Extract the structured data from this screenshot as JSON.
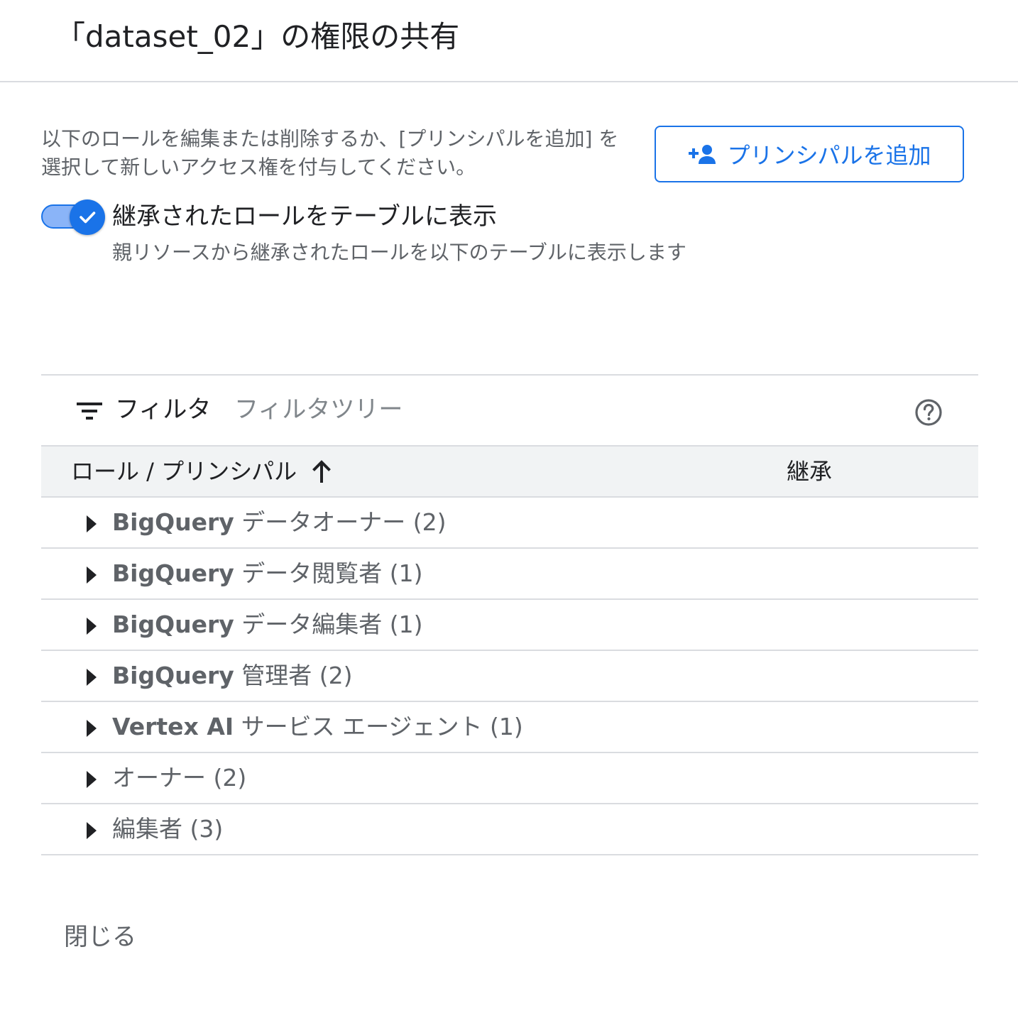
{
  "dialog": {
    "title": "「dataset_02」の権限の共有",
    "description": "以下のロールを編集または削除するか、[プリンシパルを追加] を選択して新しいアクセス権を付与してください。",
    "add_principal_label": "プリンシパルを追加",
    "close_label": "閉じる"
  },
  "toggle": {
    "checked": true,
    "label": "継承されたロールをテーブルに表示",
    "help": "親リソースから継承されたロールを以下のテーブルに表示します"
  },
  "filter": {
    "label": "フィルタ",
    "placeholder": "フィルタツリー"
  },
  "table": {
    "headers": {
      "role": "ロール / プリンシパル",
      "inherited": "継承"
    },
    "sort": "ascending",
    "rows": [
      {
        "prefix": "BigQuery",
        "label": " データオーナー (2)"
      },
      {
        "prefix": "BigQuery",
        "label": " データ閲覧者 (1)"
      },
      {
        "prefix": "BigQuery",
        "label": " データ編集者 (1)"
      },
      {
        "prefix": "BigQuery",
        "label": " 管理者 (2)"
      },
      {
        "prefix": "Vertex AI",
        "label": " サービス エージェント (1)"
      },
      {
        "prefix": "",
        "label": "オーナー (2)"
      },
      {
        "prefix": "",
        "label": "編集者 (3)"
      }
    ]
  },
  "colors": {
    "accent": "#1a73e8",
    "toggle_track": "#8ab4f8",
    "header_bg": "#f1f3f4",
    "divider": "#dadce0",
    "secondary_text": "#5f6368"
  },
  "icons": {
    "add_principal": "person-add-icon",
    "toggle_check": "check-icon",
    "filter": "filter-list-icon",
    "help": "help-outline-icon",
    "sort": "arrow-upward-icon",
    "expand": "caret-right-icon"
  }
}
